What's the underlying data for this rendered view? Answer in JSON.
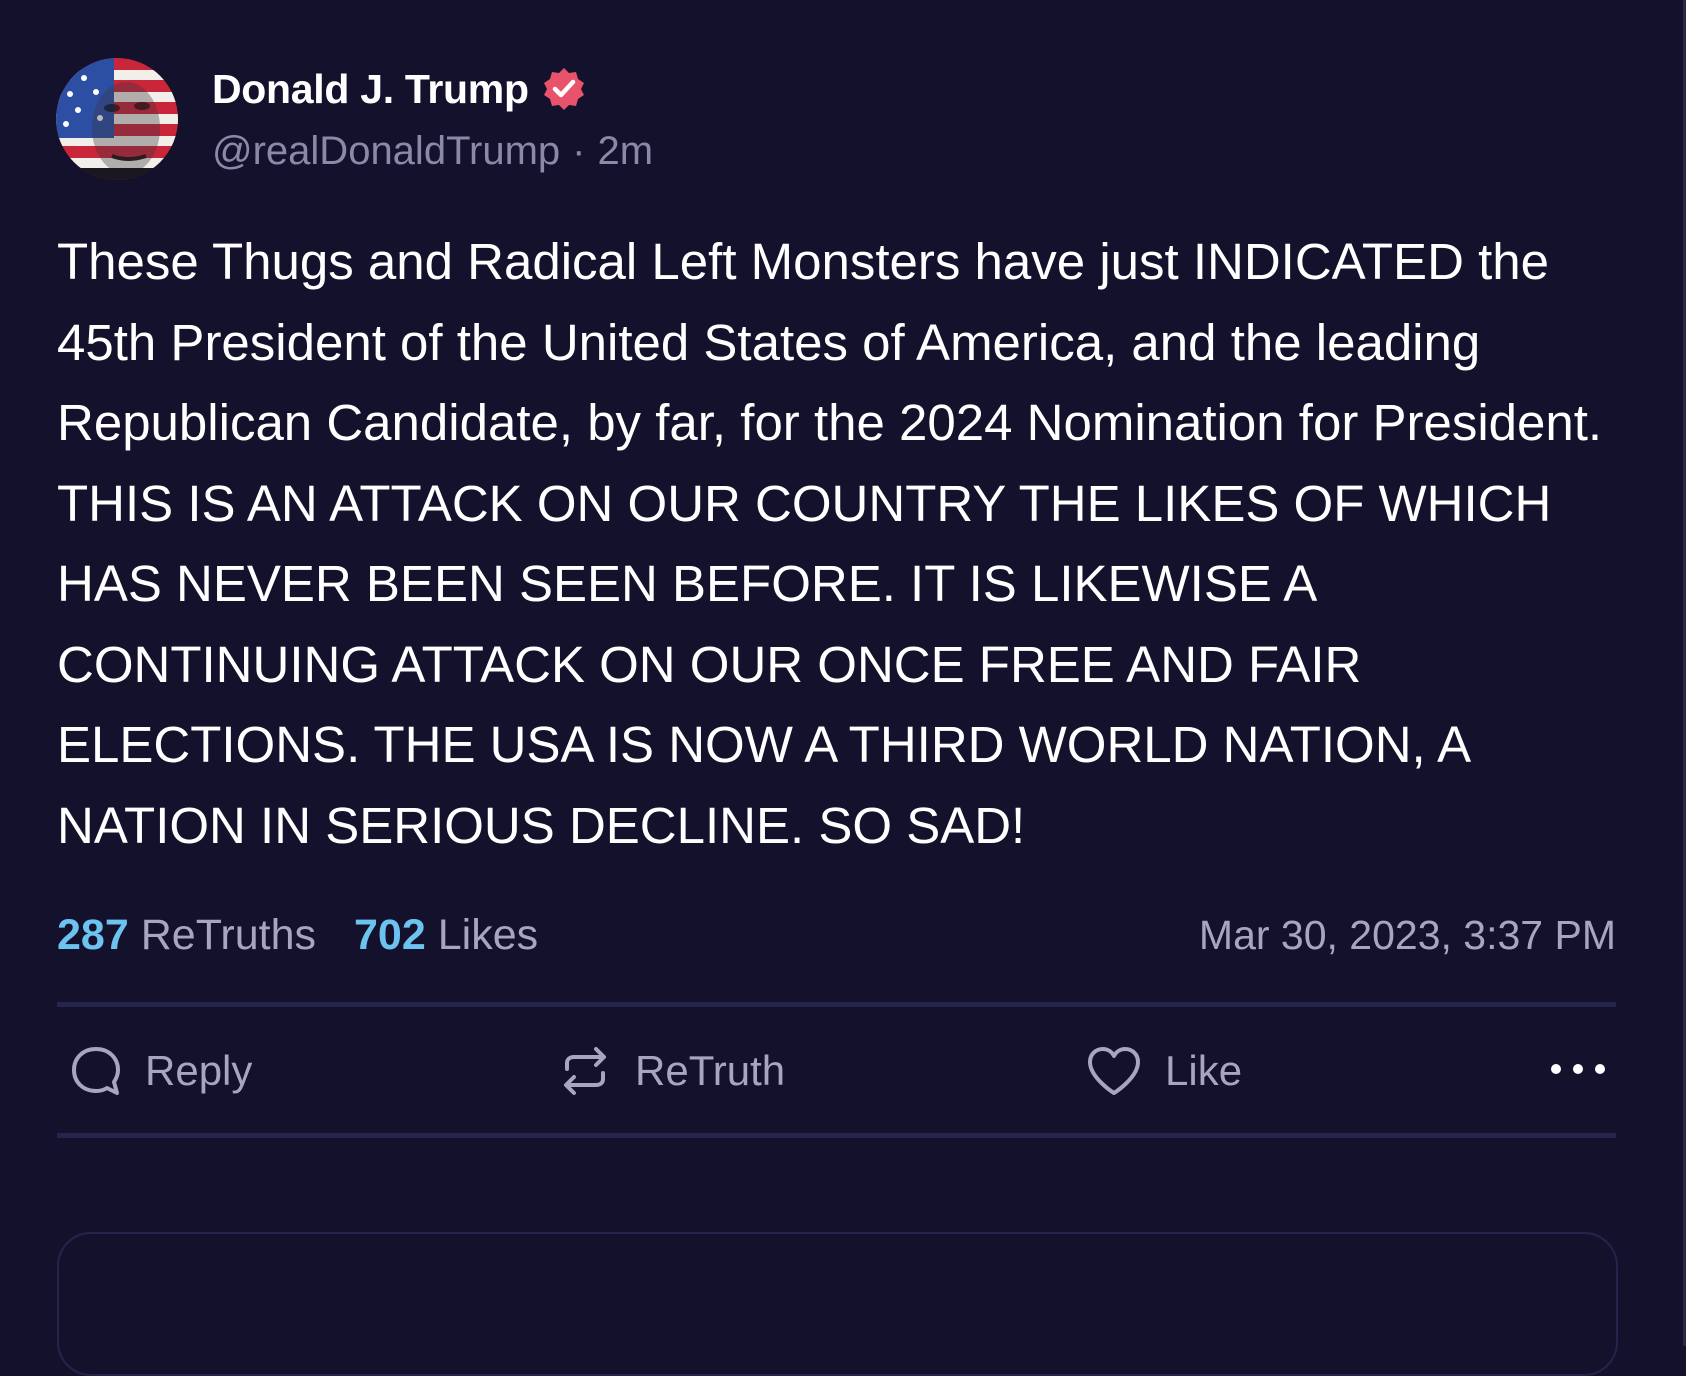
{
  "post": {
    "author": {
      "display_name": "Donald J. Trump",
      "handle": "@realDonaldTrump",
      "verified": true,
      "avatar_icon": "avatar-flag-face"
    },
    "time_ago": "2m",
    "separator": "·",
    "text": "These Thugs and Radical Left Monsters have just INDICATED the 45th President of the United States of America, and the leading Republican Candidate, by far, for the 2024 Nomination for President. THIS IS AN ATTACK ON OUR COUNTRY THE LIKES OF WHICH HAS NEVER BEEN SEEN BEFORE. IT IS LIKEWISE A CONTINUING ATTACK ON OUR ONCE FREE AND FAIR ELECTIONS. THE USA IS NOW A THIRD WORLD NATION, A NATION IN SERIOUS DECLINE. SO SAD!",
    "stats": {
      "retruths_count": "287",
      "retruths_label": "ReTruths",
      "likes_count": "702",
      "likes_label": "Likes"
    },
    "timestamp": "Mar 30, 2023, 3:37 PM"
  },
  "actions": {
    "reply": {
      "label": "Reply",
      "icon": "reply-bubble-icon"
    },
    "retruth": {
      "label": "ReTruth",
      "icon": "retruth-arrows-icon"
    },
    "like": {
      "label": "Like",
      "icon": "heart-icon"
    },
    "more": {
      "icon": "more-dots-icon"
    }
  },
  "colors": {
    "background": "#13112b",
    "stat_count": "#6cc3f0",
    "muted_text": "#a6a6bf",
    "handle_text": "#8a8aa6",
    "verified_badge": "#e8526b",
    "divider": "#25244d"
  }
}
